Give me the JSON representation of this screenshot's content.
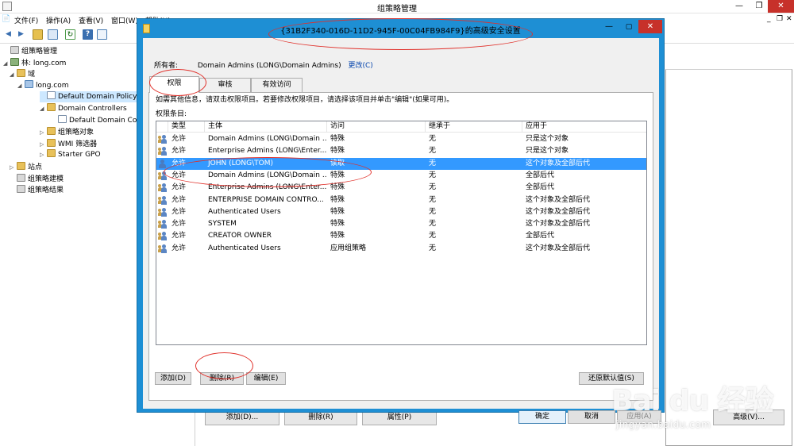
{
  "gpmc": {
    "title": "组策略管理",
    "menu": [
      "文件(F)",
      "操作(A)",
      "查看(V)",
      "窗口(W)",
      "帮助(H)"
    ],
    "tree": [
      {
        "label": "组策略管理",
        "level": 0,
        "arrow": "",
        "icon": "root"
      },
      {
        "label": "林: long.com",
        "level": 0,
        "arrow": "◢",
        "icon": "forest"
      },
      {
        "label": "域",
        "level": 1,
        "arrow": "◢",
        "icon": "folder"
      },
      {
        "label": "long.com",
        "level": 2,
        "arrow": "◢",
        "icon": "domain"
      },
      {
        "label": "Default Domain Policy",
        "level": 3,
        "arrow": "",
        "icon": "gpo",
        "selected": true
      },
      {
        "label": "Domain Controllers",
        "level": 3,
        "arrow": "◢",
        "icon": "folder"
      },
      {
        "label": "Default Domain Con",
        "level": 4,
        "arrow": "",
        "icon": "gpo"
      },
      {
        "label": "组策略对象",
        "level": 3,
        "arrow": "▷",
        "icon": "folder"
      },
      {
        "label": "WMI 筛选器",
        "level": 3,
        "arrow": "▷",
        "icon": "folder"
      },
      {
        "label": "Starter GPO",
        "level": 3,
        "arrow": "▷",
        "icon": "folder"
      },
      {
        "label": "站点",
        "level": 1,
        "arrow": "▷",
        "icon": "folder"
      },
      {
        "label": "组策略建模",
        "level": 1,
        "arrow": "",
        "icon": "root"
      },
      {
        "label": "组策略结果",
        "level": 1,
        "arrow": "",
        "icon": "root"
      }
    ],
    "bottom_buttons": {
      "add": "添加(D)...",
      "remove": "删除(R)",
      "properties": "属性(P)",
      "advanced": "高级(V)..."
    }
  },
  "dialog": {
    "title": "{31B2F340-016D-11D2-945F-00C04FB984F9}的高级安全设置",
    "owner_label": "所有者:",
    "owner_value": "Domain Admins (LONG\\Domain Admins)",
    "owner_change": "更改(C)",
    "tabs": [
      "权限",
      "审核",
      "有效访问"
    ],
    "info_text": "如需其他信息，请双击权限项目。若要修改权限项目，请选择该项目并单击\"编辑\"(如果可用)。",
    "entries_label": "权限条目:",
    "columns": [
      "类型",
      "主体",
      "访问",
      "继承于",
      "应用于"
    ],
    "rows": [
      {
        "type": "允许",
        "principal": "Domain Admins (LONG\\Domain ...",
        "access": "特殊",
        "inherited": "无",
        "applies": "只是这个对象"
      },
      {
        "type": "允许",
        "principal": "Enterprise Admins (LONG\\Enter...",
        "access": "特殊",
        "inherited": "无",
        "applies": "只是这个对象"
      },
      {
        "type": "允许",
        "principal": "JOHN (LONG\\TOM)",
        "access": "读取",
        "inherited": "无",
        "applies": "这个对象及全部后代",
        "selected": true
      },
      {
        "type": "允许",
        "principal": "Domain Admins (LONG\\Domain ...",
        "access": "特殊",
        "inherited": "无",
        "applies": "全部后代"
      },
      {
        "type": "允许",
        "principal": "Enterprise Admins (LONG\\Enter...",
        "access": "特殊",
        "inherited": "无",
        "applies": "全部后代"
      },
      {
        "type": "允许",
        "principal": "ENTERPRISE DOMAIN CONTRO...",
        "access": "特殊",
        "inherited": "无",
        "applies": "这个对象及全部后代"
      },
      {
        "type": "允许",
        "principal": "Authenticated Users",
        "access": "特殊",
        "inherited": "无",
        "applies": "这个对象及全部后代"
      },
      {
        "type": "允许",
        "principal": "SYSTEM",
        "access": "特殊",
        "inherited": "无",
        "applies": "这个对象及全部后代"
      },
      {
        "type": "允许",
        "principal": "CREATOR OWNER",
        "access": "特殊",
        "inherited": "无",
        "applies": "全部后代"
      },
      {
        "type": "允许",
        "principal": "Authenticated Users",
        "access": "应用组策略",
        "inherited": "无",
        "applies": "这个对象及全部后代"
      }
    ],
    "buttons": {
      "add": "添加(D)",
      "remove": "删除(R)",
      "edit": "编辑(E)",
      "restore": "还原默认值(S)",
      "ok": "确定",
      "cancel": "取消",
      "apply": "应用(A)"
    }
  },
  "watermark": {
    "logo": "Bai du 经验",
    "url": "jingyan.baidu.com"
  },
  "colors": {
    "dialog_frame": "#1e8fd4",
    "selection": "#3399ff",
    "close_button": "#c7312a",
    "annotation": "#e0302a"
  }
}
